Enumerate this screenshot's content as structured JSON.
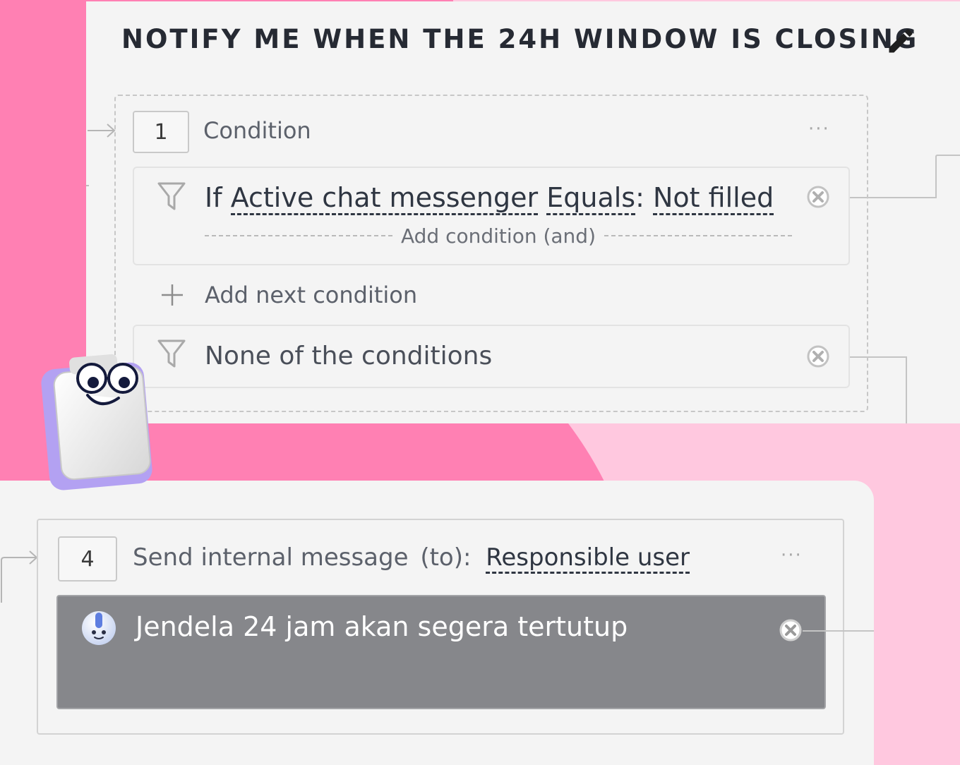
{
  "title": "NOTIFY ME WHEN THE 24H WINDOW IS CLOSING",
  "step1": {
    "number": "1",
    "label": "Condition",
    "more": "···",
    "condition": {
      "prefix": "If",
      "field": "Active chat messenger",
      "operator": "Equals",
      "colon": ":",
      "value": "Not filled",
      "add_and": "Add condition (and)"
    },
    "add_next": "Add next condition",
    "none": "None of the conditions"
  },
  "step4": {
    "number": "4",
    "label": "Send internal message",
    "to": "(to):",
    "recipient": "Responsible user",
    "more": "···",
    "message": "Jendela 24 jam akan segera tertutup"
  },
  "colors": {
    "pink_dark": "#ff80b3",
    "pink_light": "#ffc8df",
    "panel": "#f4f4f4",
    "message_bg": "#86878b"
  },
  "icons": [
    "pencil-icon",
    "filter-icon",
    "close-circle-icon",
    "plus-icon",
    "bot-avatar-icon",
    "mascot-clipboard-icon",
    "arrow-right-icon"
  ]
}
